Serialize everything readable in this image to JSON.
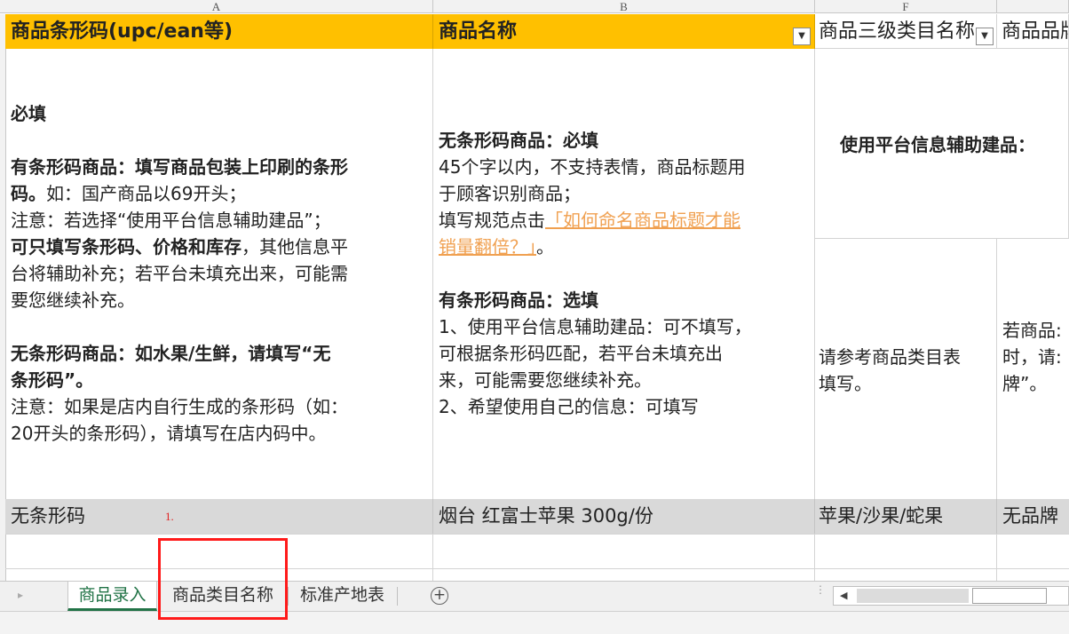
{
  "columns": {
    "a": "A",
    "b": "B",
    "f": "F"
  },
  "headers": {
    "a": "商品条形码(upc/ean等)",
    "b": "商品名称",
    "f": "商品三级类目名称",
    "g": "商品品牌"
  },
  "col_a_desc": {
    "l1": "必填",
    "l2": "有条形码商品：填写商品包装上印刷的条形",
    "l3a": "码。",
    "l3b": "如：国产商品以69开头；",
    "l4": "注意：若选择“使用平台信息辅助建品”；",
    "l5a": "可只填写条形码、价格和库存",
    "l5b": "，其他信息平",
    "l6": "台将辅助补充；若平台未填充出来，可能需",
    "l7": "要您继续补充。",
    "l8": "无条形码商品：如水果/生鲜，请填写“无",
    "l9": "条形码”。",
    "l10": "注意：如果是店内自行生成的条形码（如：",
    "l11": "20开头的条形码），请填写在店内码中。"
  },
  "col_b_desc": {
    "l1": "无条形码商品：必填",
    "l2": "45个字以内，不支持表情，商品标题用",
    "l3": "于顾客识别商品；",
    "l4a": "填写规范点击",
    "l4link": "「如何命名商品标题才能",
    "l5link": "销量翻倍？」",
    "l5b": "。",
    "l6": "有条形码商品：选填",
    "l7": "1、使用平台信息辅助建品：可不填写，",
    "l8": "可根据条形码匹配，若平台未填充出",
    "l9": "来，可能需要您继续补充。",
    "l10": "2、希望使用自己的信息：可填写"
  },
  "col_f_desc": {
    "top": "使用平台信息辅助建品：",
    "l1": "请参考商品类目表",
    "l2": "填写。"
  },
  "col_g_desc": {
    "l1": "若商品:",
    "l2": "时，请:",
    "l3": "牌”。"
  },
  "example_row": {
    "a": "无条形码",
    "marker": "1.",
    "b": "烟台 红富士苹果 300g/份",
    "f": "苹果/沙果/蛇果",
    "g": "无品牌"
  },
  "sheet_tabs": [
    {
      "label": "商品录入",
      "active": true
    },
    {
      "label": "商品类目名称",
      "active": false
    },
    {
      "label": "标准产地表",
      "active": false
    }
  ],
  "icons": {
    "add_sheet": "plus-circle-icon",
    "scroll_left": "triangle-left-icon",
    "dropdown": "dropdown-arrow-icon"
  },
  "colors": {
    "header_bg": "#ffc000",
    "link": "#f0a050",
    "active_tab": "#217346",
    "highlight_box": "#ff1a1a"
  }
}
